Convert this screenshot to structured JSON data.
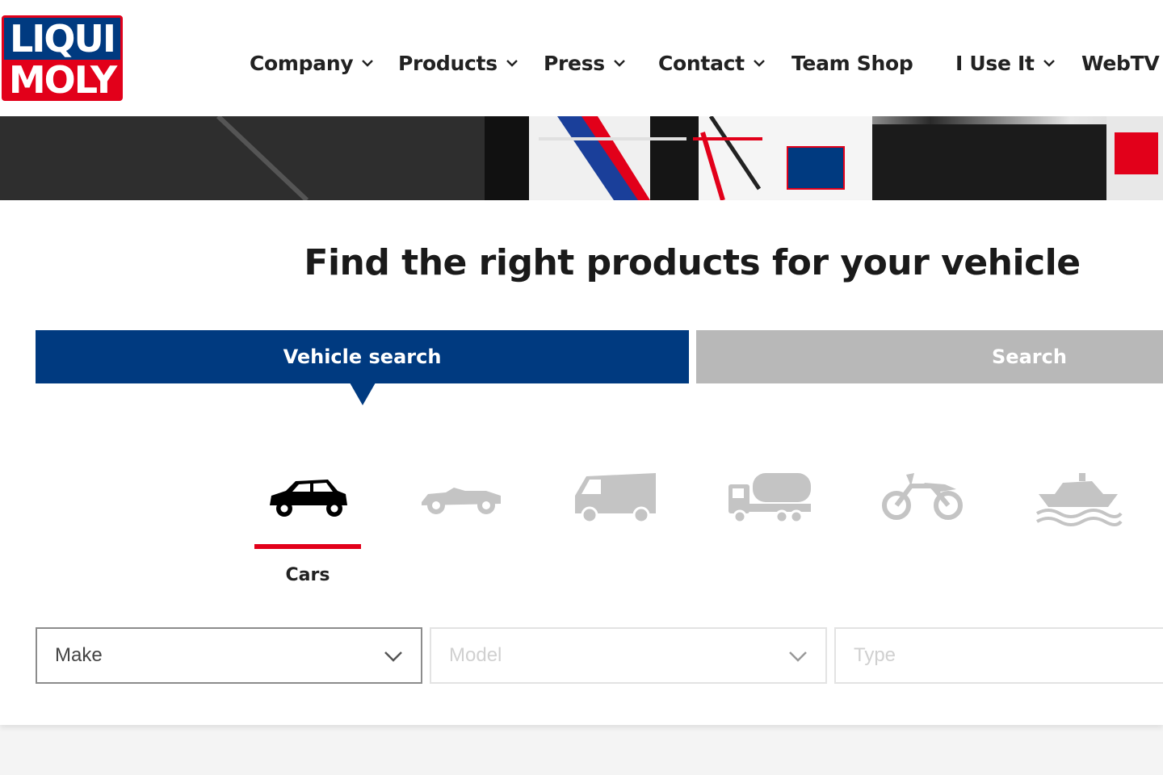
{
  "brand": {
    "logo_line1": "LIQUI",
    "logo_line2": "MOLY",
    "colors": {
      "blue": "#003a80",
      "red": "#e2001a"
    }
  },
  "nav": {
    "items": [
      {
        "label": "Company",
        "has_dropdown": true
      },
      {
        "label": "Products",
        "has_dropdown": true
      },
      {
        "label": "Press",
        "has_dropdown": true
      },
      {
        "label": "Contact",
        "has_dropdown": true
      },
      {
        "label": "Team Shop",
        "has_dropdown": false
      },
      {
        "label": "I Use It",
        "has_dropdown": true
      },
      {
        "label": "WebTV",
        "has_dropdown": false
      }
    ]
  },
  "hero": {
    "slider": {
      "slides": 2,
      "active_index": 1
    }
  },
  "main": {
    "title": "Find the right products for your vehicle",
    "tabs": [
      {
        "label": "Vehicle search",
        "active": true
      },
      {
        "label": "Search",
        "active": false
      }
    ],
    "vehicle_types": [
      {
        "icon": "car-icon",
        "label": "Cars",
        "selected": true
      },
      {
        "icon": "classic-car-icon",
        "label": "",
        "selected": false
      },
      {
        "icon": "van-icon",
        "label": "",
        "selected": false
      },
      {
        "icon": "truck-icon",
        "label": "",
        "selected": false
      },
      {
        "icon": "motorcycle-icon",
        "label": "",
        "selected": false
      },
      {
        "icon": "boat-icon",
        "label": "",
        "selected": false
      }
    ],
    "selects": {
      "make": {
        "placeholder": "Make",
        "enabled": true
      },
      "model": {
        "placeholder": "Model",
        "enabled": false
      },
      "type": {
        "placeholder": "Type",
        "enabled": false
      }
    }
  }
}
